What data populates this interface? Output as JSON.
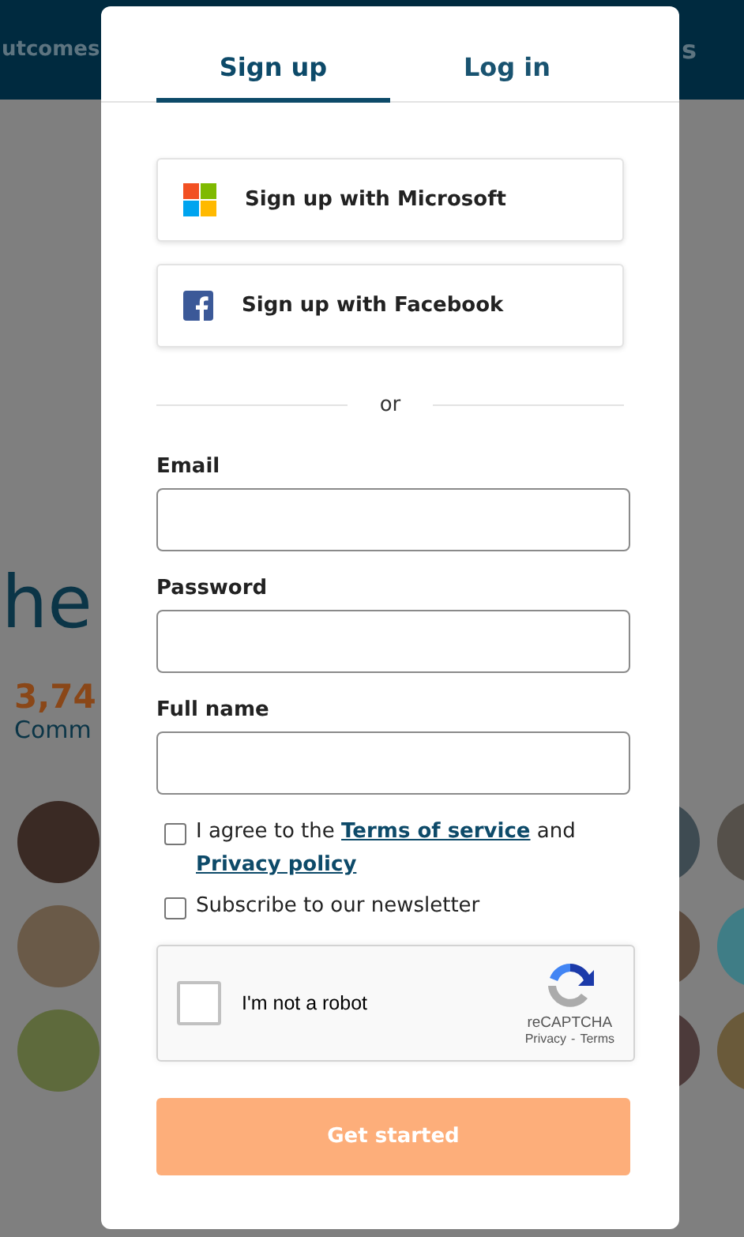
{
  "background": {
    "nav_left": "utcomes",
    "nav_right": "s",
    "heading": "he",
    "stat_value": "3,74",
    "stat_label": "Comm"
  },
  "tabs": [
    {
      "label": "Sign up",
      "selected": true
    },
    {
      "label": "Log in",
      "selected": false
    }
  ],
  "social_buttons": [
    {
      "kind": "microsoft",
      "label": "Sign up with Microsoft"
    },
    {
      "kind": "facebook",
      "label": "Sign up with Facebook"
    }
  ],
  "divider": "or",
  "fields": [
    {
      "label": "Email"
    },
    {
      "label": "Password"
    },
    {
      "label": "Full name"
    }
  ],
  "terms": {
    "checked": false,
    "text_before": "I agree to the",
    "terms_link": "Terms of service",
    "text_middle": "and",
    "privacy_link": "Privacy policy"
  },
  "newsletter": {
    "checked": false,
    "label": "Subscribe to our newsletter"
  },
  "recaptcha": {
    "checked": false,
    "label": "I'm not a robot",
    "brand": "reCAPTCHA",
    "privacy": "Privacy",
    "separator": "-",
    "terms": "Terms"
  },
  "submit": {
    "label": "Get started",
    "disabled": true
  }
}
